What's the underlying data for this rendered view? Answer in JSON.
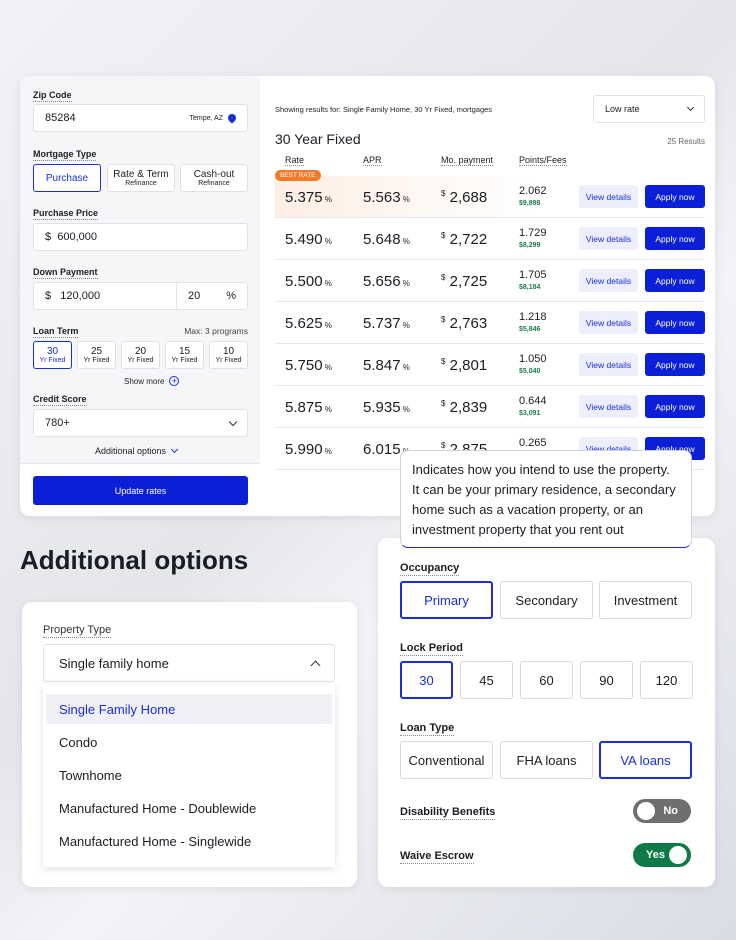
{
  "form": {
    "zip": {
      "label": "Zip Code",
      "value": "85284",
      "location": "Tempe, AZ"
    },
    "mortgage_type": {
      "label": "Mortgage Type",
      "options": [
        {
          "title": "Purchase",
          "sub": ""
        },
        {
          "title": "Rate & Term",
          "sub": "Refinance"
        },
        {
          "title": "Cash-out",
          "sub": "Refinance"
        }
      ],
      "selected": "Purchase"
    },
    "purchase_price": {
      "label": "Purchase Price",
      "currency": "$",
      "value": "600,000"
    },
    "down_payment": {
      "label": "Down Payment",
      "currency": "$",
      "value": "120,000",
      "percent": "20",
      "percent_sign": "%"
    },
    "loan_term": {
      "label": "Loan Term",
      "max": "Max: 3 programs",
      "options": [
        {
          "years": "30",
          "sub": "Yr Fixed"
        },
        {
          "years": "25",
          "sub": "Yr Fixed"
        },
        {
          "years": "20",
          "sub": "Yr Fixed"
        },
        {
          "years": "15",
          "sub": "Yr Fixed"
        },
        {
          "years": "10",
          "sub": "Yr Fixed"
        }
      ],
      "selected": "30",
      "show_more": "Show more"
    },
    "credit_score": {
      "label": "Credit Score",
      "value": "780+"
    },
    "additional_options": "Additional options",
    "update_button": "Update rates"
  },
  "results": {
    "showing": "Showing results for: Single Family Home, 30 Yr Fixed,  mortgages",
    "sort": "Low rate",
    "title": "30 Year Fixed",
    "count": "25 Results",
    "columns": [
      "Rate",
      "APR",
      "Mo. payment",
      "Points/Fees"
    ],
    "best_badge": "BEST RATE",
    "view_label": "View details",
    "apply_label": "Apply now",
    "rows": [
      {
        "rate": "5.375",
        "apr": "5.563",
        "payment": "2,688",
        "points": "2.062",
        "fees": "$9,898"
      },
      {
        "rate": "5.490",
        "apr": "5.648",
        "payment": "2,722",
        "points": "1.729",
        "fees": "$8,299"
      },
      {
        "rate": "5.500",
        "apr": "5.656",
        "payment": "2,725",
        "points": "1.705",
        "fees": "$8,184"
      },
      {
        "rate": "5.625",
        "apr": "5.737",
        "payment": "2,763",
        "points": "1.218",
        "fees": "$5,846"
      },
      {
        "rate": "5.750",
        "apr": "5.847",
        "payment": "2,801",
        "points": "1.050",
        "fees": "$5,040"
      },
      {
        "rate": "5.875",
        "apr": "5.935",
        "payment": "2,839",
        "points": "0.644",
        "fees": "$3,091"
      },
      {
        "rate": "5.990",
        "apr": "6.015",
        "payment": "2,875",
        "points": "0.265",
        "fees": ""
      }
    ]
  },
  "additional": {
    "heading": "Additional options",
    "property_type": {
      "label": "Property Type",
      "value": "Single family home",
      "options": [
        "Single Family Home",
        "Condo",
        "Townhome",
        "Manufactured Home - Doublewide",
        "Manufactured Home - Singlewide"
      ],
      "highlighted": "Single Family Home"
    },
    "tooltip": "Indicates how you intend to use the property. It can be your primary  residence, a secondary home such as a vacation property, or an investment property that you rent out",
    "occupancy": {
      "label": "Occupancy",
      "options": [
        "Primary",
        "Secondary",
        "Investment"
      ],
      "selected": "Primary"
    },
    "lock_period": {
      "label": "Lock Period",
      "options": [
        "30",
        "45",
        "60",
        "90",
        "120"
      ],
      "selected": "30"
    },
    "loan_type": {
      "label": "Loan Type",
      "options": [
        "Conventional",
        "FHA loans",
        "VA loans"
      ],
      "selected": "VA loans"
    },
    "disability": {
      "label": "Disability Benefits",
      "state": "No"
    },
    "escrow": {
      "label": "Waive Escrow",
      "state": "Yes"
    }
  },
  "colors": {
    "primary": "#0b1fd6",
    "best": "#f47a2a",
    "fee": "#1e7a4c",
    "toggle_on": "#0f7a45",
    "toggle_off": "#6f6f6f"
  }
}
